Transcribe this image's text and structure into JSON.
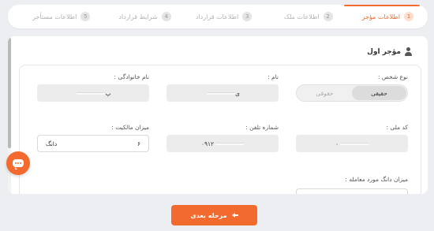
{
  "stepper": {
    "steps": [
      {
        "num": "1",
        "label": "اطلاعات مؤجر"
      },
      {
        "num": "2",
        "label": "اطلاعات ملک"
      },
      {
        "num": "3",
        "label": "اطلاعات قرارداد"
      },
      {
        "num": "4",
        "label": "شرایط قرارداد"
      },
      {
        "num": "5",
        "label": "اطلاعات مستأجر"
      }
    ],
    "active_step": 1
  },
  "section": {
    "title": "مؤجر اول"
  },
  "form": {
    "person_type": {
      "label": "نوع شخص :",
      "options": [
        "حقیقی",
        "حقوقی"
      ],
      "selected": "حقیقی"
    },
    "first_name": {
      "label": "نام :",
      "value": "ی"
    },
    "last_name": {
      "label": "نام خانوادگی :",
      "value": "پ"
    },
    "national_code": {
      "label": "کد ملی :",
      "value": "۰"
    },
    "phone": {
      "label": "شماره تلفن :",
      "value": "۰۹۱۲"
    },
    "ownership": {
      "label": "میزان مالکیت :",
      "value": "۶",
      "unit": "دانگ"
    },
    "shares": {
      "label": "میزان دانگ مورد معامله :"
    }
  },
  "actions": {
    "next_label": "مرحله بعدی"
  },
  "colors": {
    "accent": "#f26a2e",
    "background": "#eceef2"
  }
}
